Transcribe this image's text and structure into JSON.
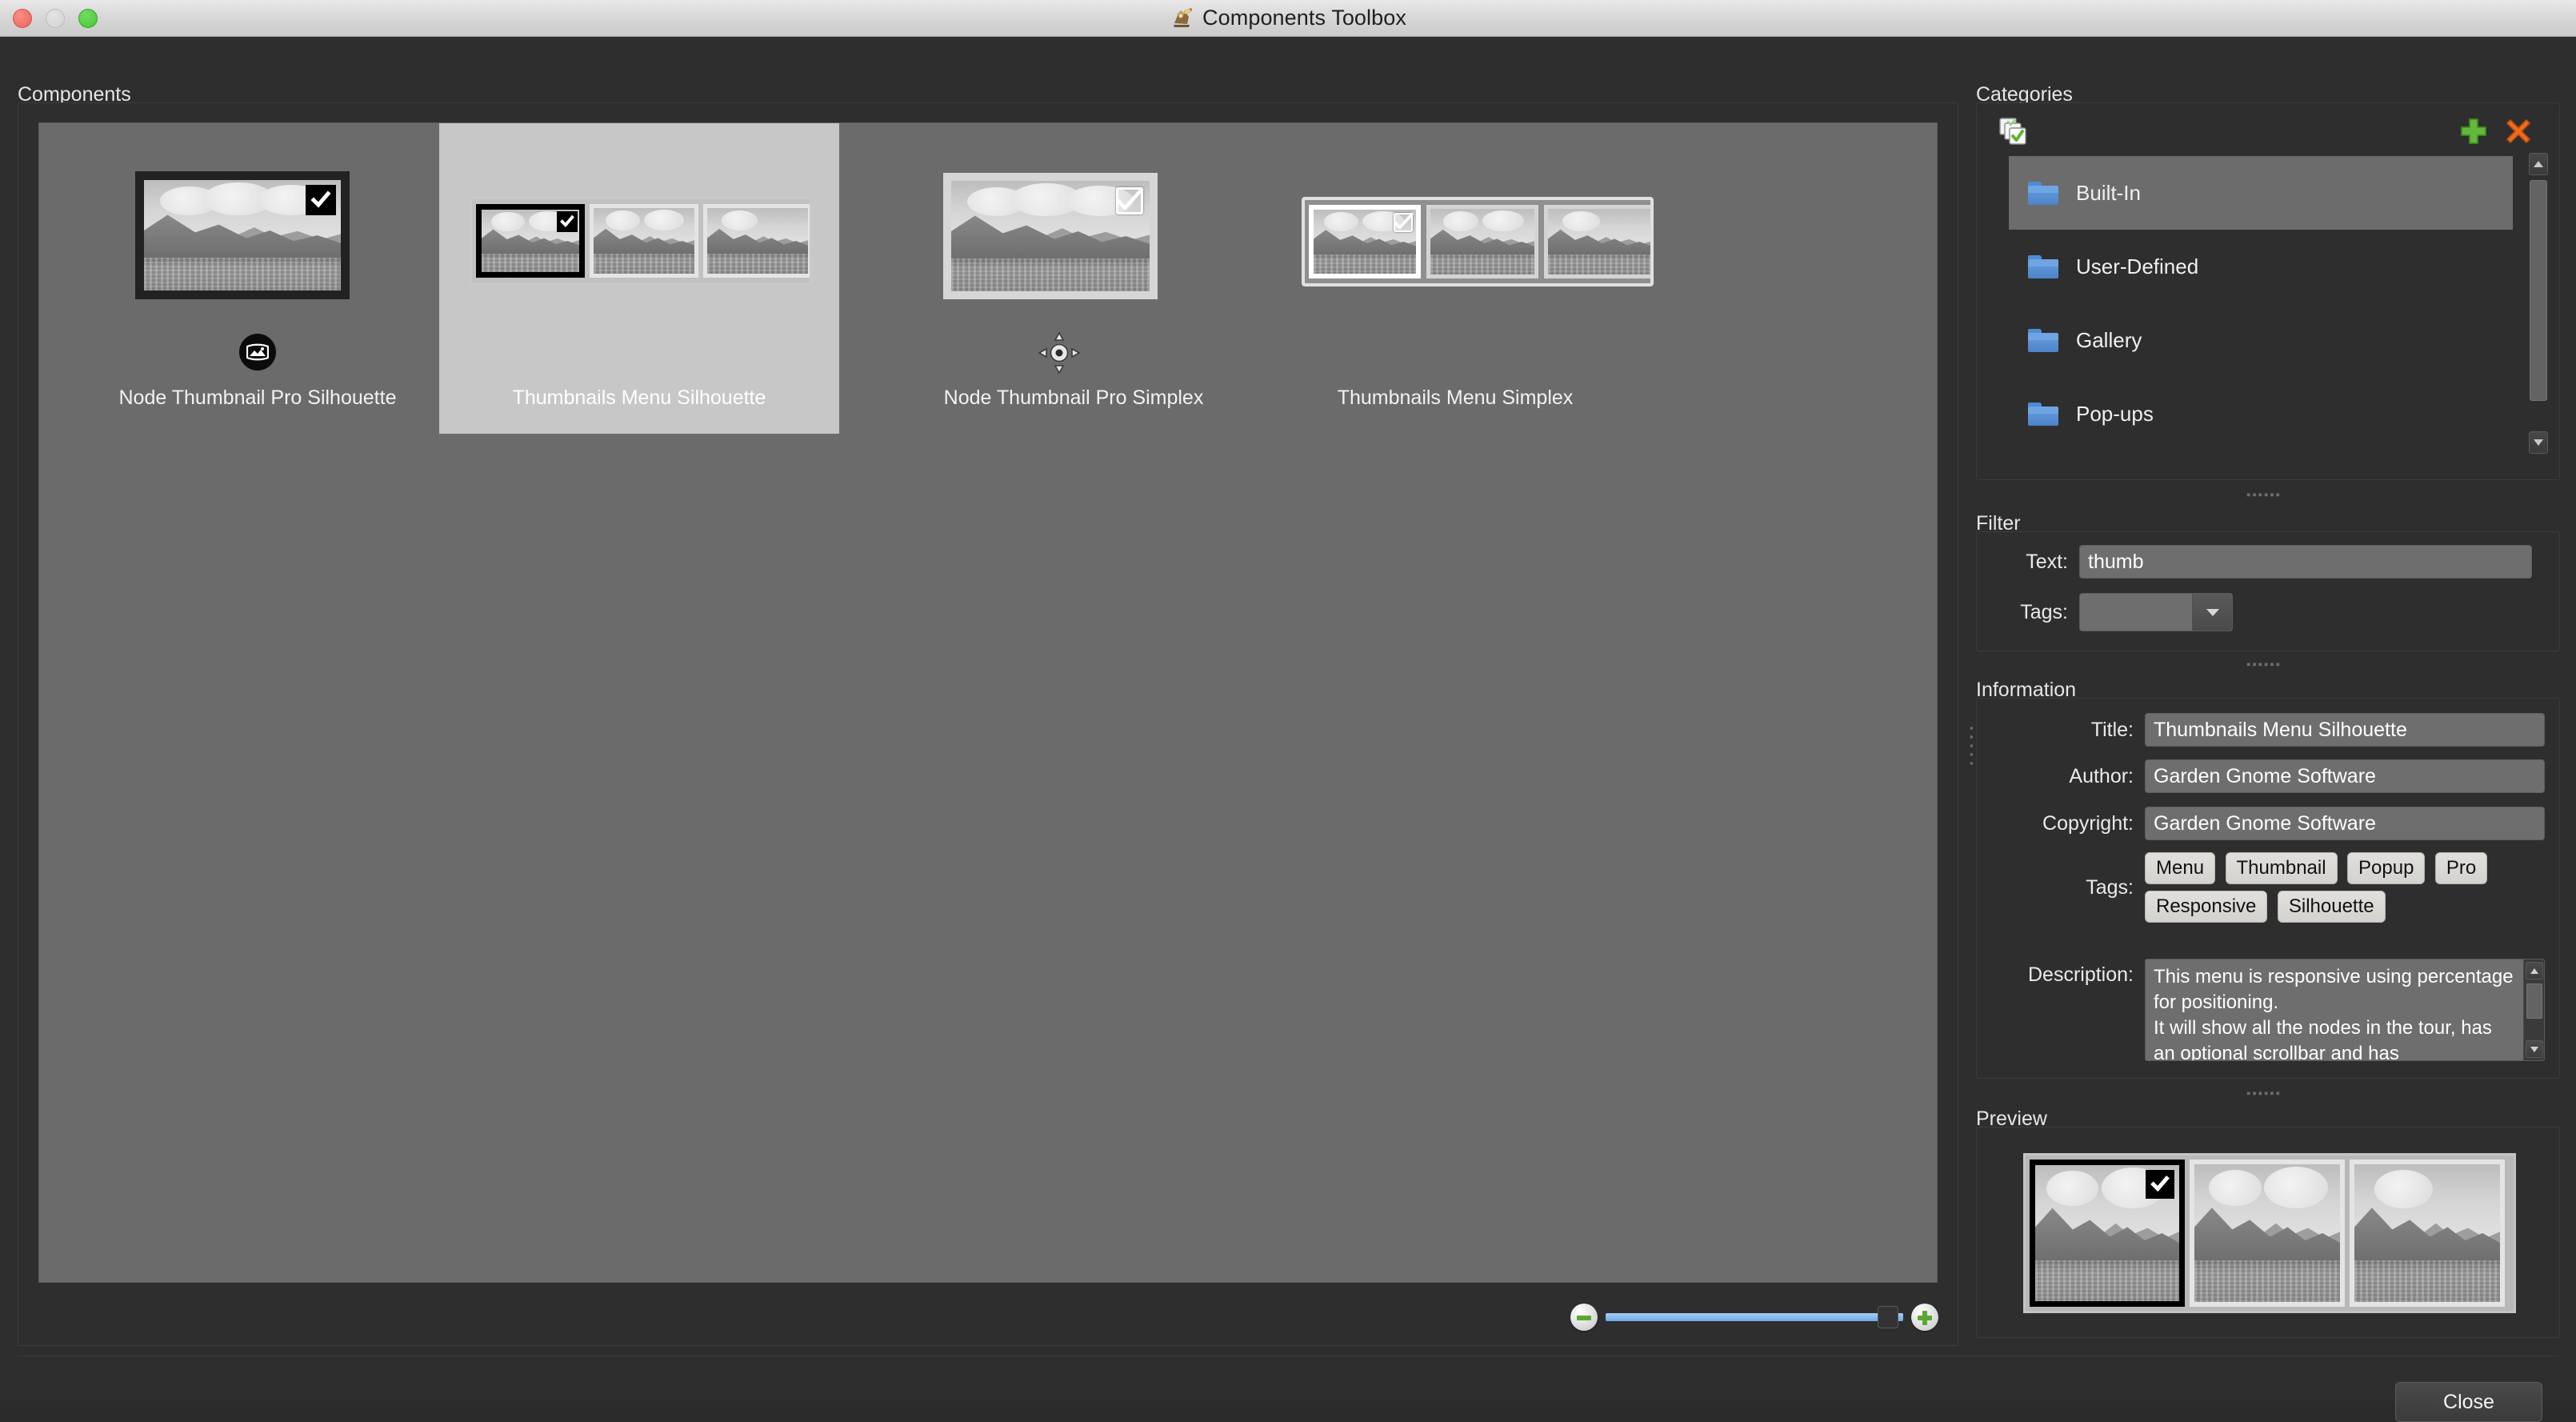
{
  "window": {
    "title": "Components Toolbox",
    "app_icon": "gnome-pencil-icon",
    "traffic_lights": [
      "close",
      "minimize",
      "maximize"
    ]
  },
  "components_panel": {
    "label": "Components",
    "items": [
      {
        "caption": "Node Thumbnail Pro Silhouette",
        "style": "single",
        "frame": "dark",
        "checkbox": "solid",
        "badge_icon": "panorama-image-icon",
        "selected": false
      },
      {
        "caption": "Thumbnails Menu Silhouette",
        "style": "strip",
        "frame": "dark",
        "checkbox": "solid",
        "badge_icon": "none",
        "selected": true
      },
      {
        "caption": "Node Thumbnail Pro Simplex",
        "style": "single",
        "frame": "light",
        "checkbox": "outline",
        "badge_icon": "hotspot-target-icon",
        "selected": false
      },
      {
        "caption": "Thumbnails Menu Simplex",
        "style": "strip",
        "frame": "light",
        "checkbox": "outline",
        "badge_icon": "none",
        "selected": false
      }
    ],
    "zoom_slider": {
      "minus_label": "zoom-out",
      "plus_label": "zoom-in",
      "value_percent": 95,
      "track_color": "#7fb0ea"
    }
  },
  "categories": {
    "label": "Categories",
    "toolbar": {
      "select_all_icon": "select-all-icon",
      "add_icon": "plus-icon",
      "remove_icon": "delete-x-icon",
      "add_color": "#5fb336",
      "remove_color": "#e8601c"
    },
    "items": [
      {
        "name": "Built-In",
        "icon": "folder-icon",
        "selected": true
      },
      {
        "name": "User-Defined",
        "icon": "folder-icon",
        "selected": false
      },
      {
        "name": "Gallery",
        "icon": "folder-icon",
        "selected": false
      },
      {
        "name": "Pop-ups",
        "icon": "folder-icon",
        "selected": false
      }
    ],
    "scrollbar": {
      "up": "scroll-up-arrow",
      "down": "scroll-down-arrow"
    }
  },
  "filter": {
    "label": "Filter",
    "text_label": "Text:",
    "text_value": "thumb",
    "text_placeholder": "",
    "tags_label": "Tags:",
    "tags_value": "",
    "tags_placeholder": ""
  },
  "information": {
    "label": "Information",
    "title_label": "Title:",
    "title_value": "Thumbnails Menu Silhouette",
    "author_label": "Author:",
    "author_value": "Garden Gnome Software",
    "copyright_label": "Copyright:",
    "copyright_value": "Garden Gnome Software",
    "tags_label": "Tags:",
    "tags": [
      "Menu",
      "Thumbnail",
      "Popup",
      "Pro",
      "Responsive",
      "Silhouette"
    ],
    "description_label": "Description:",
    "description_value": "This menu is responsive using percentage for positioning.\nIt will show all the nodes in the tour, has an optional scrollbar and has"
  },
  "preview": {
    "label": "Preview",
    "content": "thumbnails-strip-preview"
  },
  "footer": {
    "close_label": "Close"
  },
  "colors": {
    "window_bg": "#2e2e2e",
    "canvas_bg": "#6b6b6b",
    "selection_bg": "#c7c7c7",
    "list_selection_bg": "#6c6c6c",
    "field_bg": "#6e6e6e",
    "folder_blue": "#5d95d8",
    "text": "#f0f0f0"
  }
}
